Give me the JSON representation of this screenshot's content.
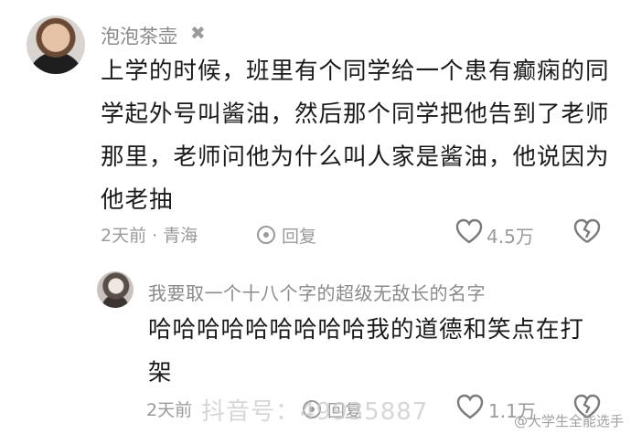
{
  "comment1": {
    "username": "泡泡茶壶",
    "verified_badge": "✖",
    "text": "上学的时候，班里有个同学给一个患有癫痫的同学起外号叫酱油，然后那个同学把他告到了老师那里，老师问他为什么叫人家是酱油，他说因为他老抽",
    "time_location": "2天前 · 青海",
    "reply_label": "回复",
    "likes": "4.5万"
  },
  "comment2": {
    "username": "我要取一个十八个字的超级无敌长的名字",
    "text": "哈哈哈哈哈哈哈哈哈我的道德和笑点在打架",
    "time": "2天前",
    "reply_label": "回复",
    "likes": "1.1万"
  },
  "watermarks": {
    "left": "抖音号：49935887",
    "right": "@大学生全能选手"
  },
  "icons": [
    "heart-icon",
    "broken-heart-icon",
    "reply-icon",
    "verified-icon"
  ]
}
